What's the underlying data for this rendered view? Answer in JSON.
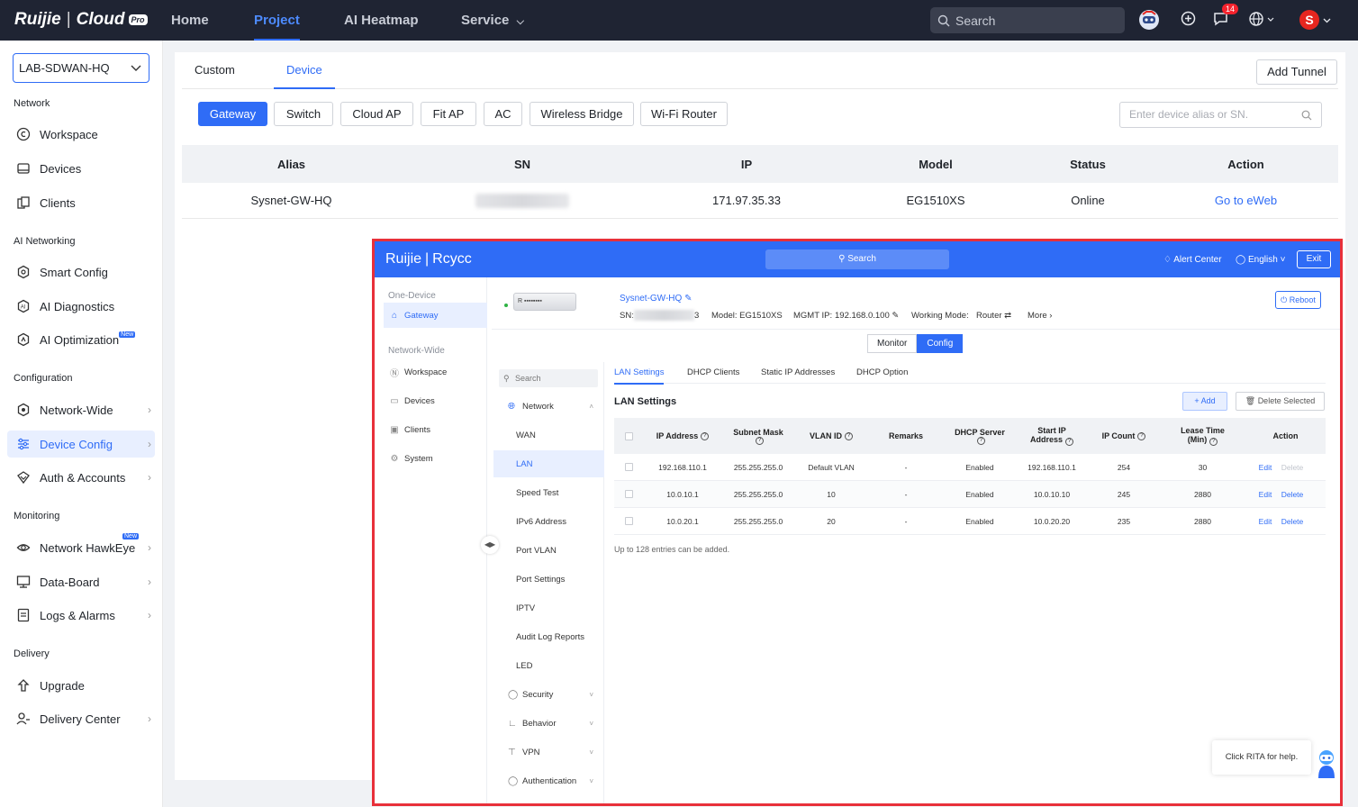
{
  "topbar": {
    "brand": "Ruijie",
    "product": "Cloud",
    "pro_tag": "Pro",
    "nav": [
      "Home",
      "Project",
      "AI Heatmap",
      "Service"
    ],
    "search_placeholder": "Search",
    "notif_count": "14",
    "avatar_letter": "S",
    "accent": "#2f6cf6"
  },
  "sidebar": {
    "project": "LAB-SDWAN-HQ",
    "sections": {
      "network": "Network",
      "ai": "AI Networking",
      "config": "Configuration",
      "monitoring": "Monitoring",
      "delivery": "Delivery"
    },
    "items": {
      "workspace": "Workspace",
      "devices": "Devices",
      "clients": "Clients",
      "smart_config": "Smart Config",
      "ai_diag": "AI Diagnostics",
      "ai_opt": "AI Optimization",
      "network_wide": "Network-Wide",
      "device_config": "Device Config",
      "auth": "Auth & Accounts",
      "hawkeye": "Network HawkEye",
      "databoard": "Data-Board",
      "logs": "Logs & Alarms",
      "upgrade": "Upgrade",
      "delivery_center": "Delivery Center"
    },
    "new_tag": "New"
  },
  "main": {
    "tabs": [
      "Custom",
      "Device"
    ],
    "add_tunnel": "Add Tunnel",
    "types": [
      "Gateway",
      "Switch",
      "Cloud AP",
      "Fit AP",
      "AC",
      "Wireless Bridge",
      "Wi-Fi Router"
    ],
    "search_placeholder": "Enter device alias or SN.",
    "columns": [
      "Alias",
      "SN",
      "IP",
      "Model",
      "Status",
      "Action"
    ],
    "rows": [
      {
        "alias": "Sysnet-GW-HQ",
        "ip": "171.97.35.33",
        "model": "EG1510XS",
        "status": "Online",
        "action": "Go to eWeb"
      }
    ]
  },
  "eweb": {
    "brand": "Ruijie",
    "product": "Rcycc",
    "search": "Search",
    "alert": "Alert Center",
    "lang": "English",
    "exit": "Exit",
    "left": {
      "one_device": "One-Device",
      "gateway": "Gateway",
      "network_wide": "Network-Wide",
      "workspace": "Workspace",
      "devices": "Devices",
      "clients": "Clients",
      "system": "System"
    },
    "device": {
      "name": "Sysnet-GW-HQ",
      "sn_label": "SN:",
      "sn_tail": "3",
      "model": "Model: EG1510XS",
      "mgmt_label": "MGMT IP:",
      "mgmt_ip": "192.168.0.100",
      "mode_label": "Working Mode:",
      "mode": "Router",
      "more": "More",
      "reboot": "Reboot",
      "img_text": "R"
    },
    "mode_toggle": [
      "Monitor",
      "Config"
    ],
    "menu": {
      "search": "Search",
      "network": "Network",
      "items": [
        "WAN",
        "LAN",
        "Speed Test",
        "IPv6 Address",
        "Port VLAN",
        "Port Settings",
        "IPTV",
        "Audit Log Reports",
        "LED"
      ],
      "groups": [
        "Security",
        "Behavior",
        "VPN",
        "Authentication"
      ]
    },
    "ctabs": [
      "LAN Settings",
      "DHCP Clients",
      "Static IP Addresses",
      "DHCP Option"
    ],
    "lan_title": "LAN Settings",
    "add": "Add",
    "delete_selected": "Delete Selected",
    "cols": {
      "ip": "IP Address",
      "mask1": "Subnet Mask",
      "vlan": "VLAN ID",
      "remarks": "Remarks",
      "dhcp1": "DHCP Server",
      "start1": "Start IP",
      "start2": "Address",
      "count": "IP Count",
      "lease1": "Lease Time",
      "lease2": "(Min)",
      "action": "Action"
    },
    "rows": [
      {
        "ip": "192.168.110.1",
        "mask": "255.255.255.0",
        "vlan": "Default VLAN",
        "remarks": "-",
        "dhcp": "Enabled",
        "start": "192.168.110.1",
        "count": "254",
        "lease": "30",
        "edit": "Edit",
        "del": "Delete"
      },
      {
        "ip": "10.0.10.1",
        "mask": "255.255.255.0",
        "vlan": "10",
        "remarks": "-",
        "dhcp": "Enabled",
        "start": "10.0.10.10",
        "count": "245",
        "lease": "2880",
        "edit": "Edit",
        "del": "Delete"
      },
      {
        "ip": "10.0.20.1",
        "mask": "255.255.255.0",
        "vlan": "20",
        "remarks": "-",
        "dhcp": "Enabled",
        "start": "10.0.20.20",
        "count": "235",
        "lease": "2880",
        "edit": "Edit",
        "del": "Delete"
      }
    ],
    "note": "Up to 128 entries can be added.",
    "rita": "Click RITA for help."
  }
}
